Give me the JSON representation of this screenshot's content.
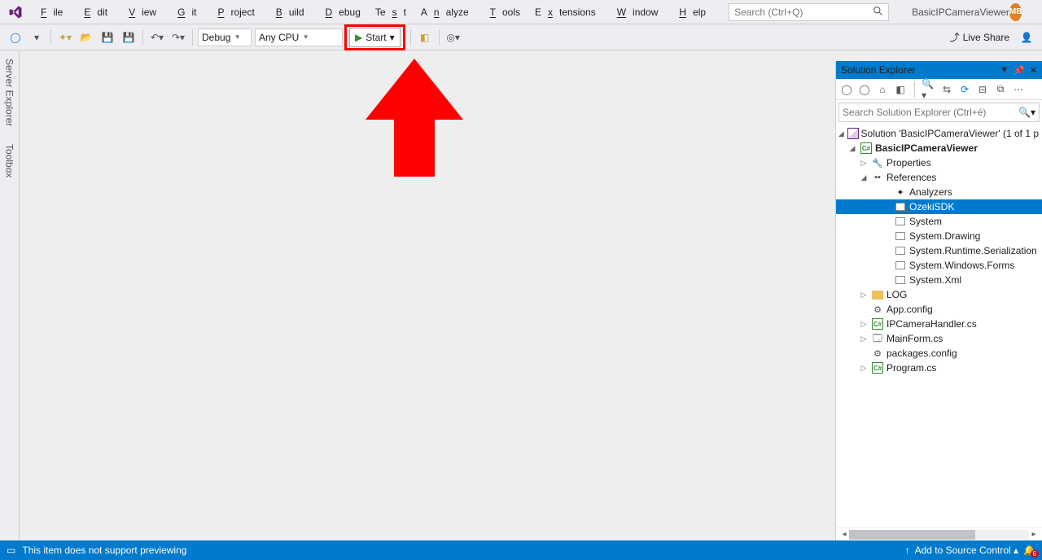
{
  "titlebar": {
    "menus": [
      "File",
      "Edit",
      "View",
      "Git",
      "Project",
      "Build",
      "Debug",
      "Test",
      "Analyze",
      "Tools",
      "Extensions",
      "Window",
      "Help"
    ],
    "search_placeholder": "Search (Ctrl+Q)",
    "project_title": "BasicIPCameraViewer",
    "user_initials": "MB"
  },
  "toolbar": {
    "config": "Debug",
    "platform": "Any CPU",
    "start_label": "Start",
    "liveshare": "Live Share"
  },
  "sidetabs": {
    "server": "Server Explorer",
    "toolbox": "Toolbox"
  },
  "solution": {
    "header": "Solution Explorer",
    "search_placeholder": "Search Solution Explorer (Ctrl+é)",
    "root": "Solution 'BasicIPCameraViewer' (1 of 1 p",
    "project": "BasicIPCameraViewer",
    "nodes": {
      "properties": "Properties",
      "references": "References",
      "analyzers": "Analyzers",
      "ozeki": "OzekiSDK",
      "system": "System",
      "drawing": "System.Drawing",
      "runtime": "System.Runtime.Serialization",
      "forms": "System.Windows.Forms",
      "xml": "System.Xml",
      "log": "LOG",
      "appconfig": "App.config",
      "ipcamera": "IPCameraHandler.cs",
      "mainform": "MainForm.cs",
      "packages": "packages.config",
      "program": "Program.cs"
    }
  },
  "statusbar": {
    "message": "This item does not support previewing",
    "source_control": "Add to Source Control",
    "notifications": "6"
  }
}
